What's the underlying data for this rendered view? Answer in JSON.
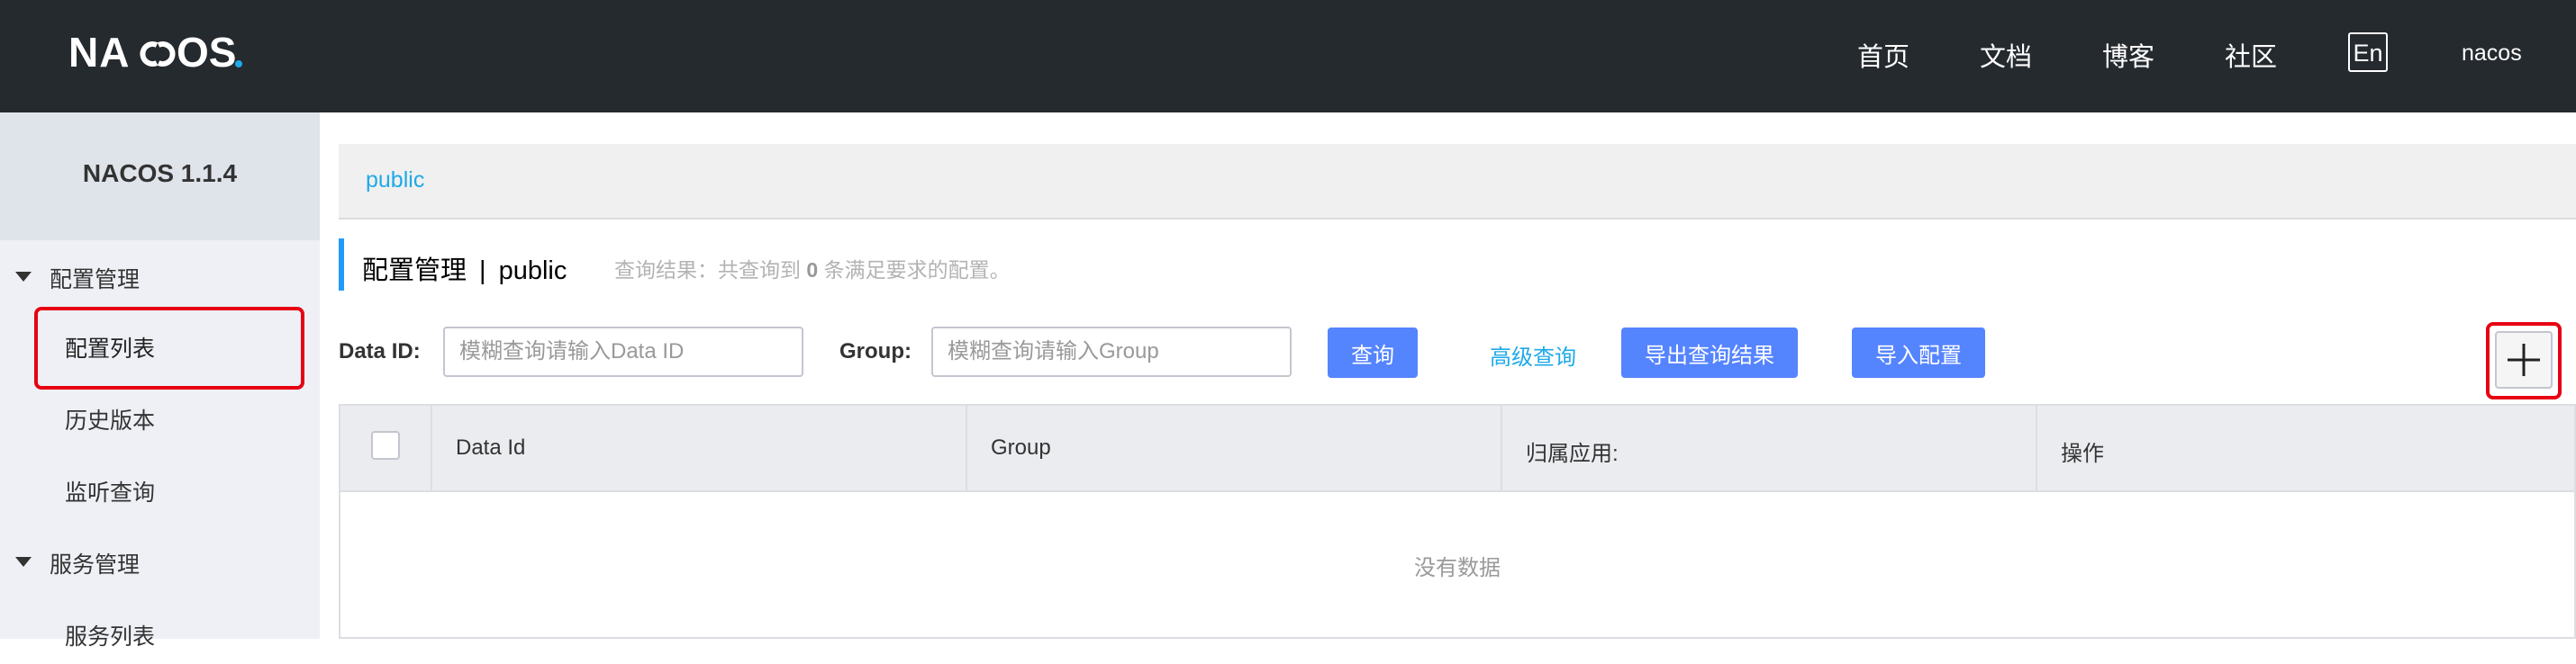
{
  "header": {
    "logo_text": "NACOS.",
    "nav": [
      "首页",
      "文档",
      "博客",
      "社区"
    ],
    "lang_button": "En",
    "user": "nacos"
  },
  "sidebar": {
    "version": "NACOS 1.1.4",
    "groups": [
      {
        "label": "配置管理",
        "items": [
          "配置列表",
          "历史版本",
          "监听查询"
        ]
      },
      {
        "label": "服务管理",
        "items": [
          "服务列表"
        ]
      }
    ]
  },
  "main": {
    "namespace": "public",
    "title": "配置管理",
    "title_sep": "|",
    "title_ns": "public",
    "query_result_prefix": "查询结果：共查询到",
    "query_result_count": "0",
    "query_result_suffix": "条满足要求的配置。",
    "search": {
      "data_id_label": "Data ID:",
      "data_id_placeholder": "模糊查询请输入Data ID",
      "group_label": "Group:",
      "group_placeholder": "模糊查询请输入Group",
      "query_button": "查询",
      "advanced_query": "高级查询",
      "export_button": "导出查询结果",
      "import_button": "导入配置"
    },
    "table": {
      "columns": [
        "Data Id",
        "Group",
        "归属应用:",
        "操作"
      ],
      "empty_text": "没有数据"
    }
  },
  "colors": {
    "header_bg": "#252a2f",
    "primary": "#5584ff",
    "link": "#1eaae7",
    "highlight_red": "#e60012"
  },
  "icons": {
    "add": "plus-icon",
    "expand": "caret-down-icon"
  }
}
